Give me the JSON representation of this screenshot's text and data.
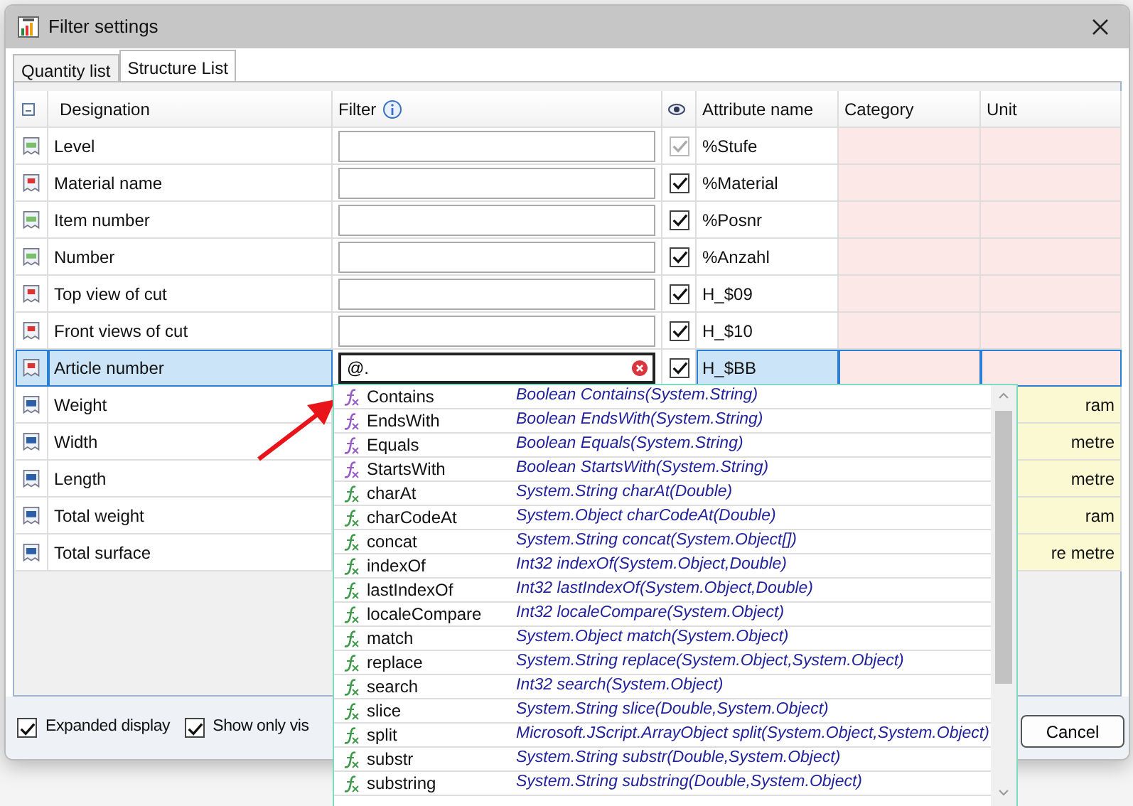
{
  "window": {
    "title": "Filter settings"
  },
  "tabs": [
    {
      "label": "Quantity list",
      "selected": false
    },
    {
      "label": "Structure List",
      "selected": true
    }
  ],
  "table": {
    "columns": [
      "Designation",
      "Filter",
      "Attribute name",
      "Category",
      "Unit"
    ],
    "rows": [
      {
        "kind": "integer",
        "designation": "Level",
        "filter": "",
        "visible": true,
        "disabled": true,
        "attribute": "%Stufe",
        "color": "#fde8e8",
        "selected": false
      },
      {
        "kind": "text",
        "designation": "Material name",
        "filter": "",
        "visible": true,
        "disabled": false,
        "attribute": "%Material",
        "color": "#fde8e8",
        "selected": false
      },
      {
        "kind": "integer",
        "designation": "Item number",
        "filter": "",
        "visible": true,
        "disabled": false,
        "attribute": "%Posnr",
        "color": "#fde8e8",
        "selected": false
      },
      {
        "kind": "integer",
        "designation": "Number",
        "filter": "",
        "visible": true,
        "disabled": false,
        "attribute": "%Anzahl",
        "color": "#fde8e8",
        "selected": false
      },
      {
        "kind": "text",
        "designation": "Top view of cut",
        "filter": "",
        "visible": true,
        "disabled": false,
        "attribute": "H_$09",
        "color": "#fde8e8",
        "selected": false
      },
      {
        "kind": "text",
        "designation": "Front views of cut",
        "filter": "",
        "visible": true,
        "disabled": false,
        "attribute": "H_$10",
        "color": "#fde8e8",
        "selected": false
      },
      {
        "kind": "text",
        "designation": "Article number",
        "filter": "@.",
        "visible": true,
        "disabled": false,
        "attribute": "H_$BB",
        "color": "#fde8e8",
        "selected": true,
        "error": true
      },
      {
        "kind": "decimal",
        "designation": "Weight",
        "unit": "ram",
        "color": "#fbf9d2",
        "selected": false
      },
      {
        "kind": "decimal",
        "designation": "Width",
        "unit": "metre",
        "color": "#fbf9d2",
        "selected": false
      },
      {
        "kind": "decimal",
        "designation": "Length",
        "unit": "metre",
        "color": "#fbf9d2",
        "selected": false
      },
      {
        "kind": "decimal",
        "designation": "Total weight",
        "unit": "ram",
        "color": "#fbf9d2",
        "selected": false
      },
      {
        "kind": "decimal",
        "designation": "Total surface",
        "unit": "re metre",
        "color": "#fbf9d2",
        "selected": false
      }
    ]
  },
  "options": [
    {
      "label": "Expanded display",
      "checked": true
    },
    {
      "label": "Show only vis",
      "checked": true
    }
  ],
  "buttons": [
    "Cancel"
  ],
  "autocomplete": [
    {
      "name": "Contains",
      "signature": "Boolean Contains(System.String)",
      "color": "#9a5cc6"
    },
    {
      "name": "EndsWith",
      "signature": "Boolean EndsWith(System.String)",
      "color": "#9a5cc6"
    },
    {
      "name": "Equals",
      "signature": "Boolean Equals(System.String)",
      "color": "#9a5cc6"
    },
    {
      "name": "StartsWith",
      "signature": "Boolean StartsWith(System.String)",
      "color": "#9a5cc6"
    },
    {
      "name": "charAt",
      "signature": "System.String charAt(Double)",
      "color": "#3f9a4a"
    },
    {
      "name": "charCodeAt",
      "signature": "System.Object charCodeAt(Double)",
      "color": "#3f9a4a"
    },
    {
      "name": "concat",
      "signature": "System.String concat(System.Object[])",
      "color": "#3f9a4a"
    },
    {
      "name": "indexOf",
      "signature": "Int32 indexOf(System.Object,Double)",
      "color": "#3f9a4a"
    },
    {
      "name": "lastIndexOf",
      "signature": "Int32 lastIndexOf(System.Object,Double)",
      "color": "#3f9a4a"
    },
    {
      "name": "localeCompare",
      "signature": "Int32 localeCompare(System.Object)",
      "color": "#3f9a4a"
    },
    {
      "name": "match",
      "signature": "System.Object match(System.Object)",
      "color": "#3f9a4a"
    },
    {
      "name": "replace",
      "signature": "System.String replace(System.Object,System.Object)",
      "color": "#3f9a4a"
    },
    {
      "name": "search",
      "signature": "Int32 search(System.Object)",
      "color": "#3f9a4a"
    },
    {
      "name": "slice",
      "signature": "System.String slice(Double,System.Object)",
      "color": "#3f9a4a"
    },
    {
      "name": "split",
      "signature": "Microsoft.JScript.ArrayObject split(System.Object,System.Object)",
      "color": "#3f9a4a"
    },
    {
      "name": "substr",
      "signature": "System.String substr(Double,System.Object)",
      "color": "#3f9a4a"
    },
    {
      "name": "substring",
      "signature": "System.String substring(Double,System.Object)",
      "color": "#3f9a4a"
    }
  ]
}
